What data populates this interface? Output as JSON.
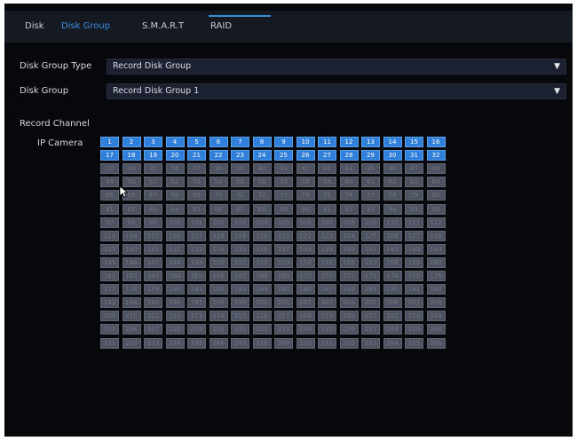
{
  "tabs": [
    {
      "label": "Disk",
      "active": false
    },
    {
      "label": "Disk Group",
      "active": true
    },
    {
      "label": "S.M.A.R.T",
      "active": false
    },
    {
      "label": "RAID",
      "active": false
    }
  ],
  "form": {
    "disk_group_type": {
      "label": "Disk Group Type",
      "value": "Record Disk Group"
    },
    "disk_group": {
      "label": "Disk Group",
      "value": "Record Disk Group 1"
    }
  },
  "record_channel": {
    "section_label": "Record Channel",
    "row_label": "IP Camera",
    "channel_count": 256,
    "columns": 16,
    "selected_count": 32
  },
  "colors": {
    "accent": "#3d8fdf",
    "selected_cell": "#2f7fdb",
    "unselected_cell": "#4d5360",
    "background": "#07080b"
  }
}
